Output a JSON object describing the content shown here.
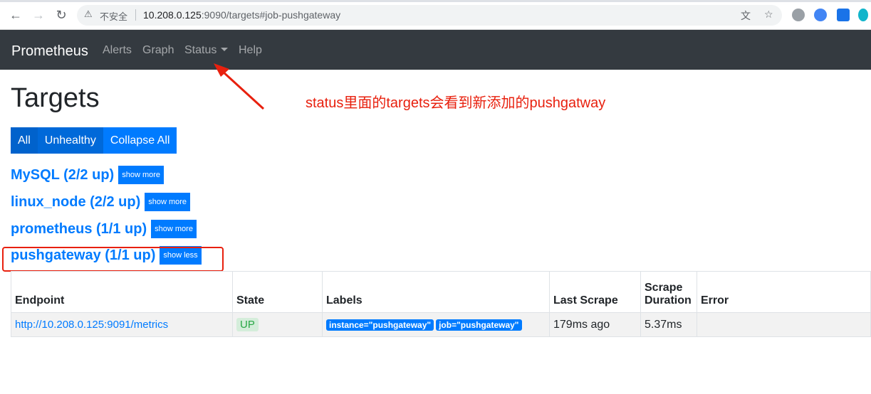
{
  "browser": {
    "warning_icon": "warning-icon",
    "insecure_text": "不安全",
    "url_host": "10.208.0.125",
    "url_rest": ":9090/targets#job-pushgateway"
  },
  "navbar": {
    "brand": "Prometheus",
    "links": [
      "Alerts",
      "Graph",
      "Status",
      "Help"
    ]
  },
  "page": {
    "title": "Targets",
    "annotation": "status里面的targets会看到新添加的pushgatway",
    "annotation_color": "#e8200e",
    "filter_buttons": [
      "All",
      "Unhealthy",
      "Collapse All"
    ]
  },
  "jobs": [
    {
      "title": "MySQL (2/2 up)",
      "toggle": "show more"
    },
    {
      "title": "linux_node (2/2 up)",
      "toggle": "show more"
    },
    {
      "title": "prometheus (1/1 up)",
      "toggle": "show more"
    },
    {
      "title": "pushgateway (1/1 up)",
      "toggle": "show less"
    }
  ],
  "table": {
    "headers": [
      "Endpoint",
      "State",
      "Labels",
      "Last Scrape",
      "Scrape Duration",
      "Error"
    ],
    "rows": [
      {
        "endpoint": "http://10.208.0.125:9091/metrics",
        "state": "UP",
        "labels": [
          "instance=\"pushgateway\"",
          "job=\"pushgateway\""
        ],
        "last_scrape": "179ms ago",
        "scrape_duration": "5.37ms",
        "error": ""
      }
    ]
  },
  "colors": {
    "accent": "#007bff",
    "navbar": "#343a40",
    "up_green": "#28a745"
  }
}
